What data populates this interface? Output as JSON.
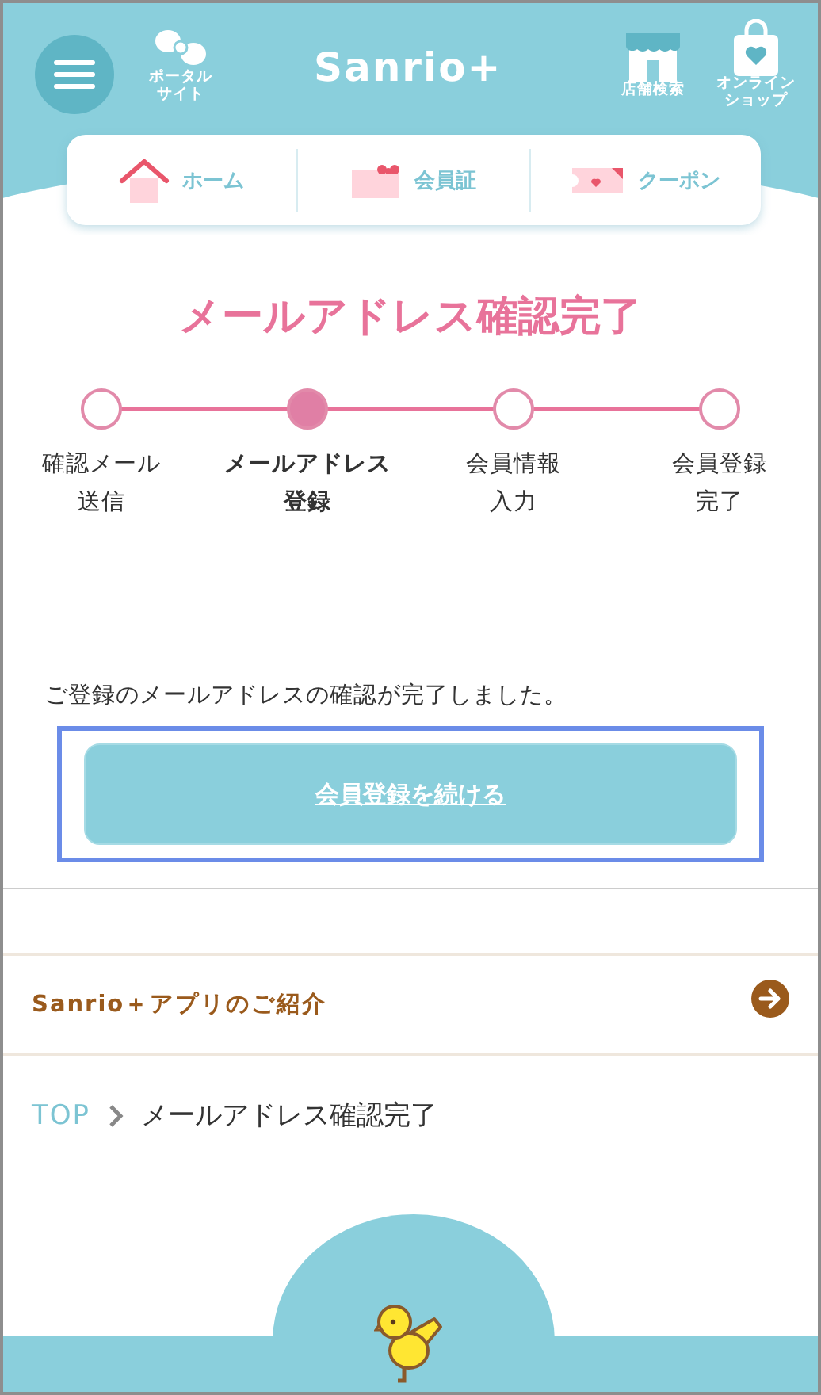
{
  "header": {
    "portal_label": [
      "ポータル",
      "サイト"
    ],
    "logo": "Sanrio+",
    "store_label": "店舗検索",
    "shop_label": [
      "オンライン",
      "ショップ"
    ]
  },
  "nav": [
    {
      "kind": "home",
      "label": "ホーム"
    },
    {
      "kind": "card",
      "label": "会員証"
    },
    {
      "kind": "coupon",
      "label": "クーポン"
    }
  ],
  "title": "メールアドレス確認完了",
  "steps": [
    {
      "label": [
        "確認メール",
        "送信"
      ],
      "selected": false
    },
    {
      "label": [
        "メールアドレス",
        "登録"
      ],
      "selected": true
    },
    {
      "label": [
        "会員情報",
        "入力"
      ],
      "selected": false
    },
    {
      "label": [
        "会員登録",
        "完了"
      ],
      "selected": false
    }
  ],
  "message": "ご登録のメールアドレスの確認が完了しました。",
  "button": {
    "label": "会員登録を続ける",
    "highlighted": true
  },
  "app_link": "Sanrio＋アプリのご紹介",
  "breadcrumb": [
    {
      "label": "TOP",
      "kind": "link"
    },
    {
      "label": "メールアドレス確認完了",
      "kind": "current"
    }
  ]
}
